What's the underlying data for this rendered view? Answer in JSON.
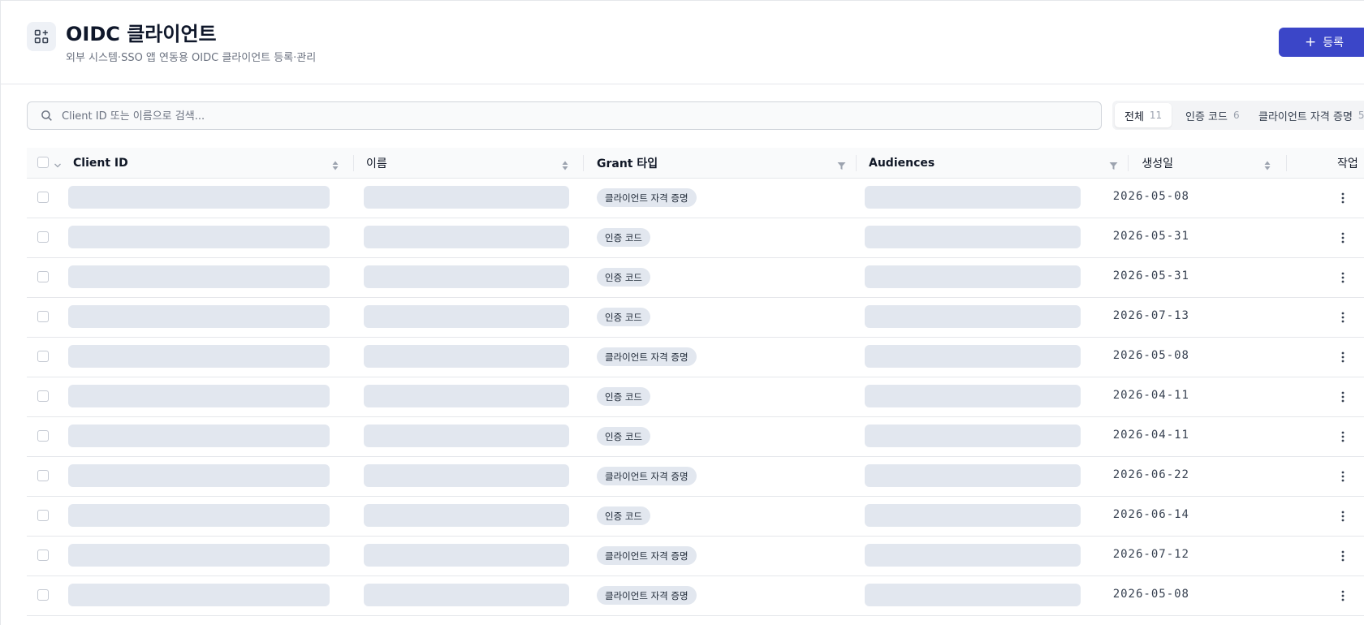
{
  "header": {
    "title": "OIDC 클라이언트",
    "subtitle": "외부 시스템·SSO 앱 연동용 OIDC 클라이언트 등록·관리",
    "icon": "apps-add-icon",
    "register_label": "등록"
  },
  "search": {
    "placeholder": "Client ID 또는 이름으로 검색...",
    "value": ""
  },
  "filters": [
    {
      "label": "전체",
      "count": "11",
      "active": true
    },
    {
      "label": "인증 코드",
      "count": "6",
      "active": false
    },
    {
      "label": "클라이언트 자격 증명",
      "count": "5",
      "active": false
    }
  ],
  "table": {
    "columns": {
      "client_id": "Client ID",
      "name": "이름",
      "grant_type": "Grant 타입",
      "audiences": "Audiences",
      "created": "생성일",
      "actions": "작업"
    },
    "rows": [
      {
        "grant": "클라이언트 자격 증명",
        "created": "2026-05-08"
      },
      {
        "grant": "인증 코드",
        "created": "2026-05-31"
      },
      {
        "grant": "인증 코드",
        "created": "2026-05-31"
      },
      {
        "grant": "인증 코드",
        "created": "2026-07-13"
      },
      {
        "grant": "클라이언트 자격 증명",
        "created": "2026-05-08"
      },
      {
        "grant": "인증 코드",
        "created": "2026-04-11"
      },
      {
        "grant": "인증 코드",
        "created": "2026-04-11"
      },
      {
        "grant": "클라이언트 자격 증명",
        "created": "2026-06-22"
      },
      {
        "grant": "인증 코드",
        "created": "2026-06-14"
      },
      {
        "grant": "클라이언트 자격 증명",
        "created": "2026-07-12"
      },
      {
        "grant": "클라이언트 자격 증명",
        "created": "2026-05-08"
      }
    ]
  },
  "colors": {
    "accent": "#3b46c8",
    "skeleton": "#e2e7ef",
    "border": "#e5e7eb"
  }
}
